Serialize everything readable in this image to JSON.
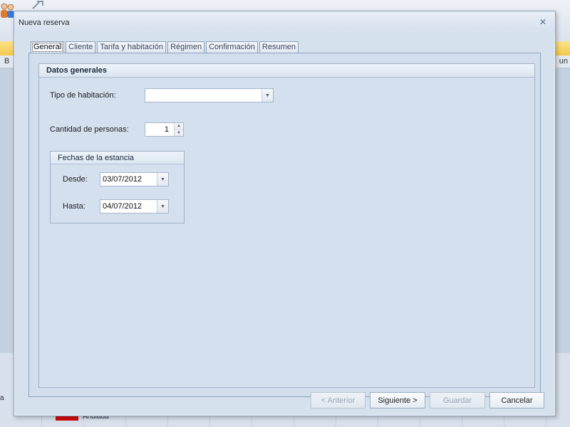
{
  "background": {
    "grid_header_left": "B",
    "grid_header_right": "un",
    "bottom_text_left": "a",
    "legend_text": "Anulada"
  },
  "dialog": {
    "title": "Nueva reserva",
    "close_glyph": "✕",
    "tabs": [
      {
        "label": "General",
        "active": true
      },
      {
        "label": "Cliente",
        "active": false
      },
      {
        "label": "Tarifa y habitación",
        "active": false
      },
      {
        "label": "Régimen",
        "active": false
      },
      {
        "label": "Confirmación",
        "active": false
      },
      {
        "label": "Resumen",
        "active": false
      }
    ],
    "group_title": "Datos generales",
    "room_type": {
      "label": "Tipo de habitación:",
      "value": ""
    },
    "persons": {
      "label": "Cantidad de personas:",
      "value": "1"
    },
    "dates_group": {
      "title": "Fechas de la estancia",
      "from": {
        "label": "Desde:",
        "value": "03/07/2012"
      },
      "to": {
        "label": "Hasta:",
        "value": "04/07/2012"
      }
    },
    "buttons": {
      "previous": "< Anterior",
      "next": "Siguiente >",
      "save": "Guardar",
      "cancel": "Cancelar"
    }
  },
  "colors": {
    "dialog_background": "#d6e1ee",
    "toolbar_band": "#f3c94b",
    "legend_red": "#d20a0a"
  }
}
